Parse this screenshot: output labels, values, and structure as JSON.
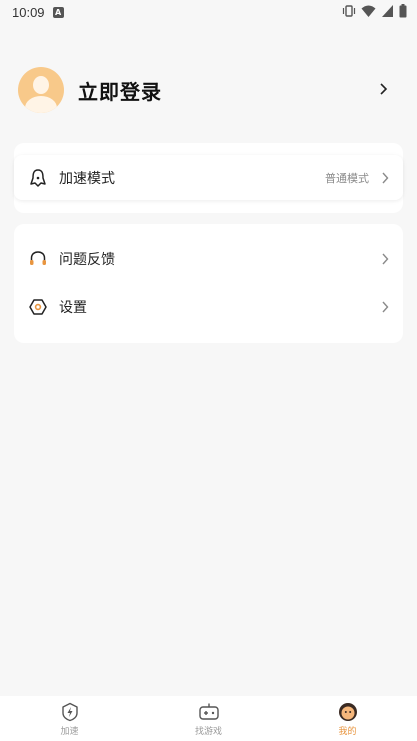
{
  "status_bar": {
    "time": "10:09",
    "notification_icon": "A"
  },
  "profile": {
    "login_label": "立即登录"
  },
  "menu_card_1": {
    "items": [
      {
        "label": "加速模式",
        "value": "普通模式",
        "icon": "ghost-icon"
      }
    ]
  },
  "menu_card_2": {
    "items": [
      {
        "label": "问题反馈",
        "icon": "headset-icon"
      },
      {
        "label": "设置",
        "icon": "hexagon-gear-icon"
      }
    ]
  },
  "tabbar": {
    "tabs": [
      {
        "label": "加速",
        "icon": "lightning-shield-icon",
        "active": false
      },
      {
        "label": "找游戏",
        "icon": "gamepad-icon",
        "active": false
      },
      {
        "label": "我的",
        "icon": "profile-face-icon",
        "active": true
      }
    ]
  },
  "colors": {
    "accent": "#e8953f",
    "avatar": "#f8c98a",
    "background": "#f7f7f7"
  }
}
